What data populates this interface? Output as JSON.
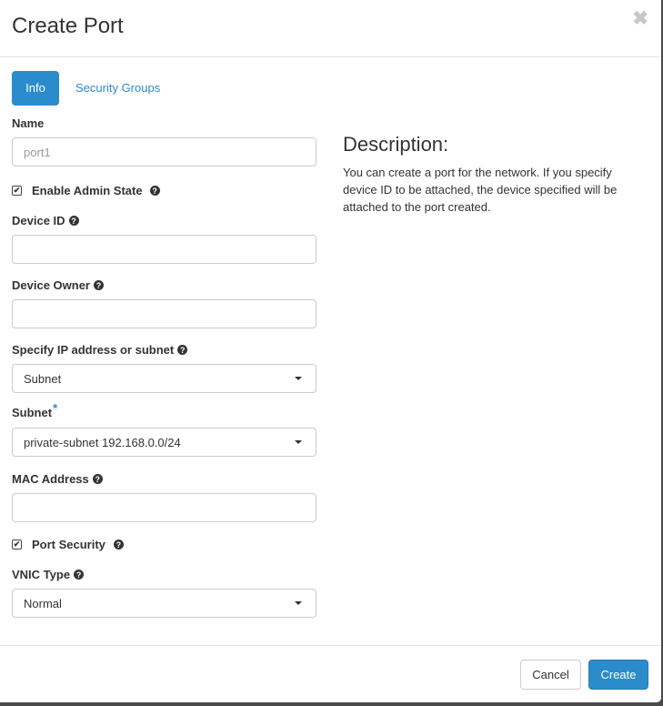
{
  "modal": {
    "title": "Create Port",
    "close_icon": "close-icon"
  },
  "tabs": [
    {
      "label": "Info",
      "active": true
    },
    {
      "label": "Security Groups",
      "active": false
    }
  ],
  "form": {
    "name": {
      "label": "Name",
      "value": "",
      "placeholder": "port1"
    },
    "admin_state": {
      "label": "Enable Admin State",
      "checked": true
    },
    "device_id": {
      "label": "Device ID",
      "value": ""
    },
    "device_owner": {
      "label": "Device Owner",
      "value": ""
    },
    "ip_or_subnet": {
      "label": "Specify IP address or subnet",
      "selected": "Subnet"
    },
    "subnet": {
      "label": "Subnet",
      "required_mark": "*",
      "selected": "private-subnet 192.168.0.0/24"
    },
    "mac_address": {
      "label": "MAC Address",
      "value": ""
    },
    "port_security": {
      "label": "Port Security",
      "checked": true
    },
    "vnic_type": {
      "label": "VNIC Type",
      "selected": "Normal"
    }
  },
  "description": {
    "title": "Description:",
    "text": "You can create a port for the network. If you specify device ID to be attached, the device specified will be attached to the port created."
  },
  "footer": {
    "cancel_label": "Cancel",
    "create_label": "Create"
  },
  "icons": {
    "help_glyph": "?",
    "check_glyph": "✔",
    "close_glyph": "✖"
  },
  "colors": {
    "accent": "#2b8ccb"
  }
}
